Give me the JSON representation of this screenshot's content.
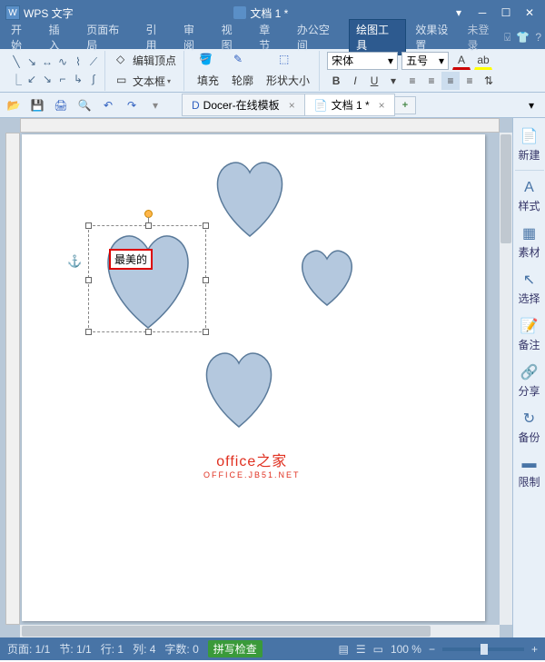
{
  "titlebar": {
    "app": "WPS 文字",
    "doc": "文档 1 *"
  },
  "menu": {
    "items": [
      "开始",
      "插入",
      "页面布局",
      "引用",
      "审阅",
      "视图",
      "章节",
      "办公空间",
      "绘图工具",
      "效果设置"
    ],
    "active": 8,
    "login": "未登录"
  },
  "ribbon": {
    "edit_vertex": "编辑顶点",
    "textbox": "文本框",
    "fill": "填充",
    "outline": "轮廓",
    "size": "形状大小",
    "font_name": "宋体",
    "font_size": "五号"
  },
  "tabs": {
    "t1": "Docer-在线模板",
    "t2": "文档 1 *"
  },
  "side": {
    "new": "新建",
    "style": "样式",
    "material": "素材",
    "select": "选择",
    "note": "备注",
    "share": "分享",
    "backup": "备份",
    "limit": "限制"
  },
  "shape_text": "最美的",
  "watermark": {
    "l1": "office之家",
    "l2": "OFFICE.JB51.NET"
  },
  "status": {
    "page": "页面: 1/1",
    "section": "节: 1/1",
    "line": "行: 1",
    "col": "列: 4",
    "words": "字数: 0",
    "spell": "拼写检查",
    "zoom": "100 %"
  }
}
